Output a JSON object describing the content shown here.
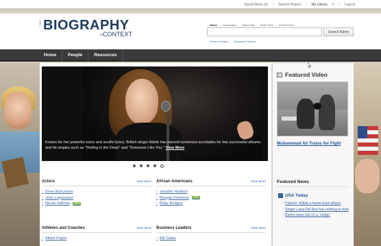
{
  "utility_links": [
    "Saved Items (0)",
    "Search History",
    "My Library",
    "Logout"
  ],
  "logo": {
    "the": "THE",
    "biography": "BIOGRAPHY",
    "in": "IN",
    "context": "CONTEXT"
  },
  "search": {
    "options": [
      "Name",
      "Occupation",
      "Nationality",
      "Birth Place",
      "Death Place"
    ],
    "placeholder": "",
    "button": "Search Name",
    "links": [
      "Person Search",
      "Advanced Search"
    ]
  },
  "nav": [
    "Home",
    "People",
    "Resources"
  ],
  "hero": {
    "caption": "Known for her powerful voice and soulful lyrics, British singer Adele has earned numerous accolades for two successful albums and hit singles such as \"Rolling in the Deep\" and \"Someone Like You.\"",
    "view_more": "View More"
  },
  "sections": [
    {
      "title": "Actors",
      "more": "View More",
      "items": [
        {
          "name": "Drew Barrymore",
          "new": false
        },
        {
          "name": "John Leguizamo",
          "new": false
        },
        {
          "name": "Nicole Kidman",
          "new": true
        }
      ]
    },
    {
      "title": "African Americans",
      "more": "View More",
      "items": [
        {
          "name": "Jennifer Hudson",
          "new": false
        },
        {
          "name": "Morgan Freeman",
          "new": true
        },
        {
          "name": "Ruby Bridges",
          "new": false
        }
      ]
    },
    {
      "title": "Athletes and Coaches",
      "more": "View More",
      "items": [
        {
          "name": "Albert Pujols",
          "new": false
        }
      ]
    },
    {
      "title": "Business Leaders",
      "more": "View More",
      "items": [
        {
          "name": "Bill Gates",
          "new": false
        }
      ]
    }
  ],
  "new_badge": "NEW",
  "featured_video": {
    "title": "Featured Video",
    "link": "Muhammad Ali Trains for Fight"
  },
  "featured_news": {
    "title": "Featured News",
    "source": "USA Today",
    "items": [
      "Palouts' Vidlek a home-team player",
      "Singer Lana Del Rey has nothing to hide",
      "Banks stays out on a 'Ledge'"
    ]
  },
  "colors": {
    "nav_bg": "#3a3a3a",
    "logo": "#1e3a5f",
    "link": "#3a67a8",
    "new_badge": "#7cb342"
  }
}
